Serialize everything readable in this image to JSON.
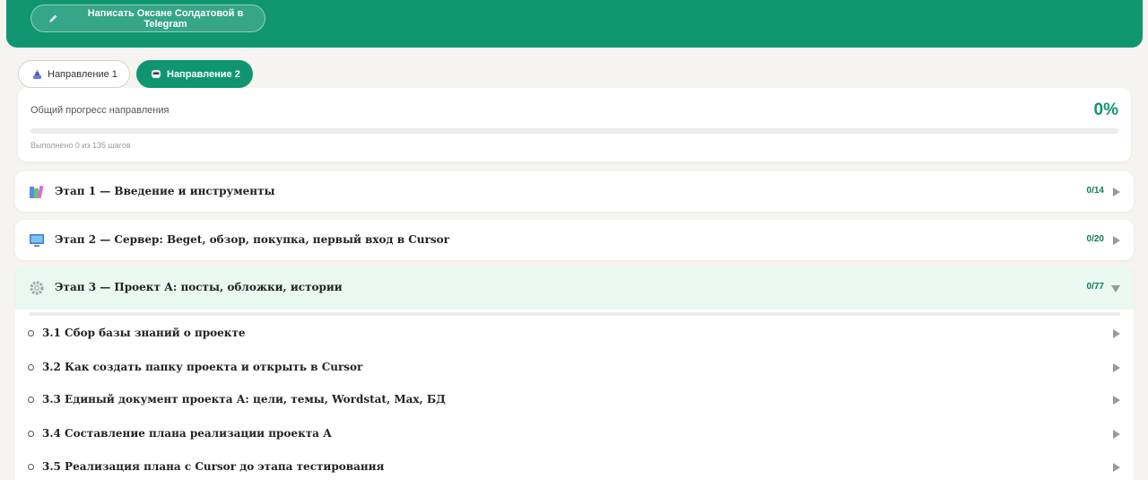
{
  "header": {
    "telegram_button": "Написать Оксане Солдатовой в Telegram",
    "accent_color": "#0f9670"
  },
  "tabs": [
    {
      "label": "Направление 1",
      "icon": "mage-icon",
      "active": false
    },
    {
      "label": "Направление 2",
      "icon": "mask-icon",
      "active": true
    }
  ],
  "progress": {
    "label": "Общий прогресс направления",
    "percent": "0%",
    "value": 0,
    "subtext": "Выполнено 0 из 135 шагов"
  },
  "stages": [
    {
      "title": "Этап 1 — Введение и инструменты",
      "count": "0/14",
      "icon": "books-icon",
      "open": false
    },
    {
      "title": "Этап 2 — Сервер: Beget, обзор, покупка, первый вход в Cursor",
      "count": "0/20",
      "icon": "monitor-icon",
      "open": false
    },
    {
      "title": "Этап 3 — Проект А: посты, обложки, истории",
      "count": "0/77",
      "icon": "gear-icon",
      "open": true
    }
  ],
  "substeps": [
    {
      "label": "3.1 Сбор базы знаний о проекте"
    },
    {
      "label": "3.2 Как создать папку проекта и открыть в Cursor"
    },
    {
      "label": "3.3 Единый документ проекта А: цели, темы, Wordstat, Max, БД"
    },
    {
      "label": "3.4 Составление плана реализации проекта А"
    },
    {
      "label": "3.5 Реализация плана с Cursor до этапа тестирования"
    }
  ]
}
